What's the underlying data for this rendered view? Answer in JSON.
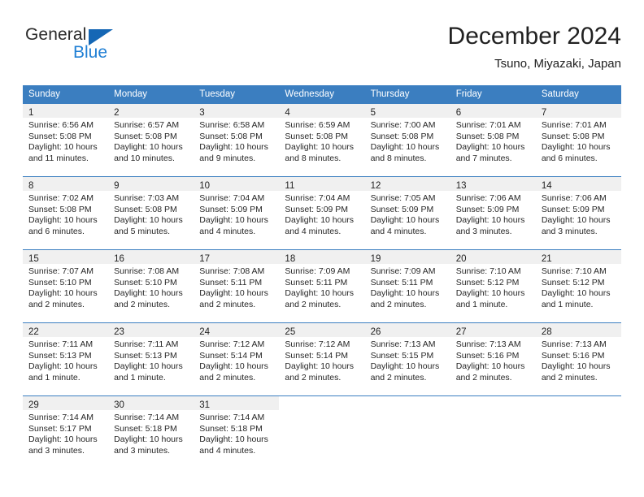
{
  "brand": {
    "name_part1": "General",
    "name_part2": "Blue",
    "triangle_color": "#1567b5",
    "blue_color": "#1f7fd4"
  },
  "header": {
    "title": "December 2024",
    "subtitle": "Tsuno, Miyazaki, Japan"
  },
  "theme": {
    "header_blue": "#3b7ec0",
    "day_cell_gray": "#f0f0f0"
  },
  "weekdays": [
    "Sunday",
    "Monday",
    "Tuesday",
    "Wednesday",
    "Thursday",
    "Friday",
    "Saturday"
  ],
  "weeks": [
    [
      {
        "day": "1",
        "sunrise": "Sunrise: 6:56 AM",
        "sunset": "Sunset: 5:08 PM",
        "daylight1": "Daylight: 10 hours",
        "daylight2": "and 11 minutes."
      },
      {
        "day": "2",
        "sunrise": "Sunrise: 6:57 AM",
        "sunset": "Sunset: 5:08 PM",
        "daylight1": "Daylight: 10 hours",
        "daylight2": "and 10 minutes."
      },
      {
        "day": "3",
        "sunrise": "Sunrise: 6:58 AM",
        "sunset": "Sunset: 5:08 PM",
        "daylight1": "Daylight: 10 hours",
        "daylight2": "and 9 minutes."
      },
      {
        "day": "4",
        "sunrise": "Sunrise: 6:59 AM",
        "sunset": "Sunset: 5:08 PM",
        "daylight1": "Daylight: 10 hours",
        "daylight2": "and 8 minutes."
      },
      {
        "day": "5",
        "sunrise": "Sunrise: 7:00 AM",
        "sunset": "Sunset: 5:08 PM",
        "daylight1": "Daylight: 10 hours",
        "daylight2": "and 8 minutes."
      },
      {
        "day": "6",
        "sunrise": "Sunrise: 7:01 AM",
        "sunset": "Sunset: 5:08 PM",
        "daylight1": "Daylight: 10 hours",
        "daylight2": "and 7 minutes."
      },
      {
        "day": "7",
        "sunrise": "Sunrise: 7:01 AM",
        "sunset": "Sunset: 5:08 PM",
        "daylight1": "Daylight: 10 hours",
        "daylight2": "and 6 minutes."
      }
    ],
    [
      {
        "day": "8",
        "sunrise": "Sunrise: 7:02 AM",
        "sunset": "Sunset: 5:08 PM",
        "daylight1": "Daylight: 10 hours",
        "daylight2": "and 6 minutes."
      },
      {
        "day": "9",
        "sunrise": "Sunrise: 7:03 AM",
        "sunset": "Sunset: 5:08 PM",
        "daylight1": "Daylight: 10 hours",
        "daylight2": "and 5 minutes."
      },
      {
        "day": "10",
        "sunrise": "Sunrise: 7:04 AM",
        "sunset": "Sunset: 5:09 PM",
        "daylight1": "Daylight: 10 hours",
        "daylight2": "and 4 minutes."
      },
      {
        "day": "11",
        "sunrise": "Sunrise: 7:04 AM",
        "sunset": "Sunset: 5:09 PM",
        "daylight1": "Daylight: 10 hours",
        "daylight2": "and 4 minutes."
      },
      {
        "day": "12",
        "sunrise": "Sunrise: 7:05 AM",
        "sunset": "Sunset: 5:09 PM",
        "daylight1": "Daylight: 10 hours",
        "daylight2": "and 4 minutes."
      },
      {
        "day": "13",
        "sunrise": "Sunrise: 7:06 AM",
        "sunset": "Sunset: 5:09 PM",
        "daylight1": "Daylight: 10 hours",
        "daylight2": "and 3 minutes."
      },
      {
        "day": "14",
        "sunrise": "Sunrise: 7:06 AM",
        "sunset": "Sunset: 5:09 PM",
        "daylight1": "Daylight: 10 hours",
        "daylight2": "and 3 minutes."
      }
    ],
    [
      {
        "day": "15",
        "sunrise": "Sunrise: 7:07 AM",
        "sunset": "Sunset: 5:10 PM",
        "daylight1": "Daylight: 10 hours",
        "daylight2": "and 2 minutes."
      },
      {
        "day": "16",
        "sunrise": "Sunrise: 7:08 AM",
        "sunset": "Sunset: 5:10 PM",
        "daylight1": "Daylight: 10 hours",
        "daylight2": "and 2 minutes."
      },
      {
        "day": "17",
        "sunrise": "Sunrise: 7:08 AM",
        "sunset": "Sunset: 5:11 PM",
        "daylight1": "Daylight: 10 hours",
        "daylight2": "and 2 minutes."
      },
      {
        "day": "18",
        "sunrise": "Sunrise: 7:09 AM",
        "sunset": "Sunset: 5:11 PM",
        "daylight1": "Daylight: 10 hours",
        "daylight2": "and 2 minutes."
      },
      {
        "day": "19",
        "sunrise": "Sunrise: 7:09 AM",
        "sunset": "Sunset: 5:11 PM",
        "daylight1": "Daylight: 10 hours",
        "daylight2": "and 2 minutes."
      },
      {
        "day": "20",
        "sunrise": "Sunrise: 7:10 AM",
        "sunset": "Sunset: 5:12 PM",
        "daylight1": "Daylight: 10 hours",
        "daylight2": "and 1 minute."
      },
      {
        "day": "21",
        "sunrise": "Sunrise: 7:10 AM",
        "sunset": "Sunset: 5:12 PM",
        "daylight1": "Daylight: 10 hours",
        "daylight2": "and 1 minute."
      }
    ],
    [
      {
        "day": "22",
        "sunrise": "Sunrise: 7:11 AM",
        "sunset": "Sunset: 5:13 PM",
        "daylight1": "Daylight: 10 hours",
        "daylight2": "and 1 minute."
      },
      {
        "day": "23",
        "sunrise": "Sunrise: 7:11 AM",
        "sunset": "Sunset: 5:13 PM",
        "daylight1": "Daylight: 10 hours",
        "daylight2": "and 1 minute."
      },
      {
        "day": "24",
        "sunrise": "Sunrise: 7:12 AM",
        "sunset": "Sunset: 5:14 PM",
        "daylight1": "Daylight: 10 hours",
        "daylight2": "and 2 minutes."
      },
      {
        "day": "25",
        "sunrise": "Sunrise: 7:12 AM",
        "sunset": "Sunset: 5:14 PM",
        "daylight1": "Daylight: 10 hours",
        "daylight2": "and 2 minutes."
      },
      {
        "day": "26",
        "sunrise": "Sunrise: 7:13 AM",
        "sunset": "Sunset: 5:15 PM",
        "daylight1": "Daylight: 10 hours",
        "daylight2": "and 2 minutes."
      },
      {
        "day": "27",
        "sunrise": "Sunrise: 7:13 AM",
        "sunset": "Sunset: 5:16 PM",
        "daylight1": "Daylight: 10 hours",
        "daylight2": "and 2 minutes."
      },
      {
        "day": "28",
        "sunrise": "Sunrise: 7:13 AM",
        "sunset": "Sunset: 5:16 PM",
        "daylight1": "Daylight: 10 hours",
        "daylight2": "and 2 minutes."
      }
    ],
    [
      {
        "day": "29",
        "sunrise": "Sunrise: 7:14 AM",
        "sunset": "Sunset: 5:17 PM",
        "daylight1": "Daylight: 10 hours",
        "daylight2": "and 3 minutes."
      },
      {
        "day": "30",
        "sunrise": "Sunrise: 7:14 AM",
        "sunset": "Sunset: 5:18 PM",
        "daylight1": "Daylight: 10 hours",
        "daylight2": "and 3 minutes."
      },
      {
        "day": "31",
        "sunrise": "Sunrise: 7:14 AM",
        "sunset": "Sunset: 5:18 PM",
        "daylight1": "Daylight: 10 hours",
        "daylight2": "and 4 minutes."
      },
      {
        "day": "",
        "sunrise": "",
        "sunset": "",
        "daylight1": "",
        "daylight2": ""
      },
      {
        "day": "",
        "sunrise": "",
        "sunset": "",
        "daylight1": "",
        "daylight2": ""
      },
      {
        "day": "",
        "sunrise": "",
        "sunset": "",
        "daylight1": "",
        "daylight2": ""
      },
      {
        "day": "",
        "sunrise": "",
        "sunset": "",
        "daylight1": "",
        "daylight2": ""
      }
    ]
  ]
}
